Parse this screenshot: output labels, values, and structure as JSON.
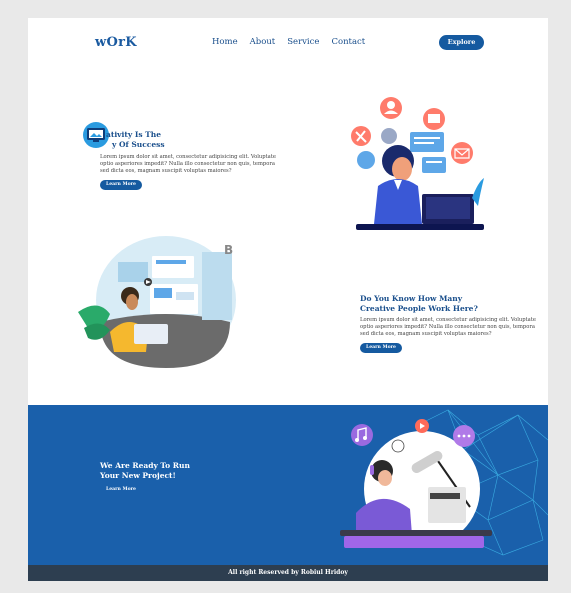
{
  "nav": {
    "logo": "wOrK",
    "links": [
      "Home",
      "About",
      "Service",
      "Contact"
    ],
    "explore_label": "Explore"
  },
  "section1": {
    "title_line1": "ativity Is The",
    "title_line2": "y Of Success",
    "body": "Lorem ipsum dolor sit amet, consectetur adipisicing elit. Voluptate optio asperiores impedit? Nulla illo consectetur non quis, tempora sed dicta eos, magnam suscipit voluptas maiores?",
    "button": "Learn More"
  },
  "section2": {
    "title_line1": "Do You Know How Many",
    "title_line2": "Creative People Work Here?",
    "body": "Lorem ipsum dolor sit amet, consectetur adipisicing elit. Voluptate optio asperiores impedit? Nulla illo consectetur non quis, tempora sed dicta eos, magnam suscipit voluptas maiores?",
    "button": "Learn More"
  },
  "cta": {
    "title_line1": "We Are Ready To Run",
    "title_line2": "Your New Project!",
    "button": "Learn More"
  },
  "footer": {
    "text": "All right Reserved by Robiul Hridoy"
  },
  "colors": {
    "brand": "#155aa0",
    "cta_bg": "#1a60ab",
    "footer_bg": "#2d3e50"
  }
}
